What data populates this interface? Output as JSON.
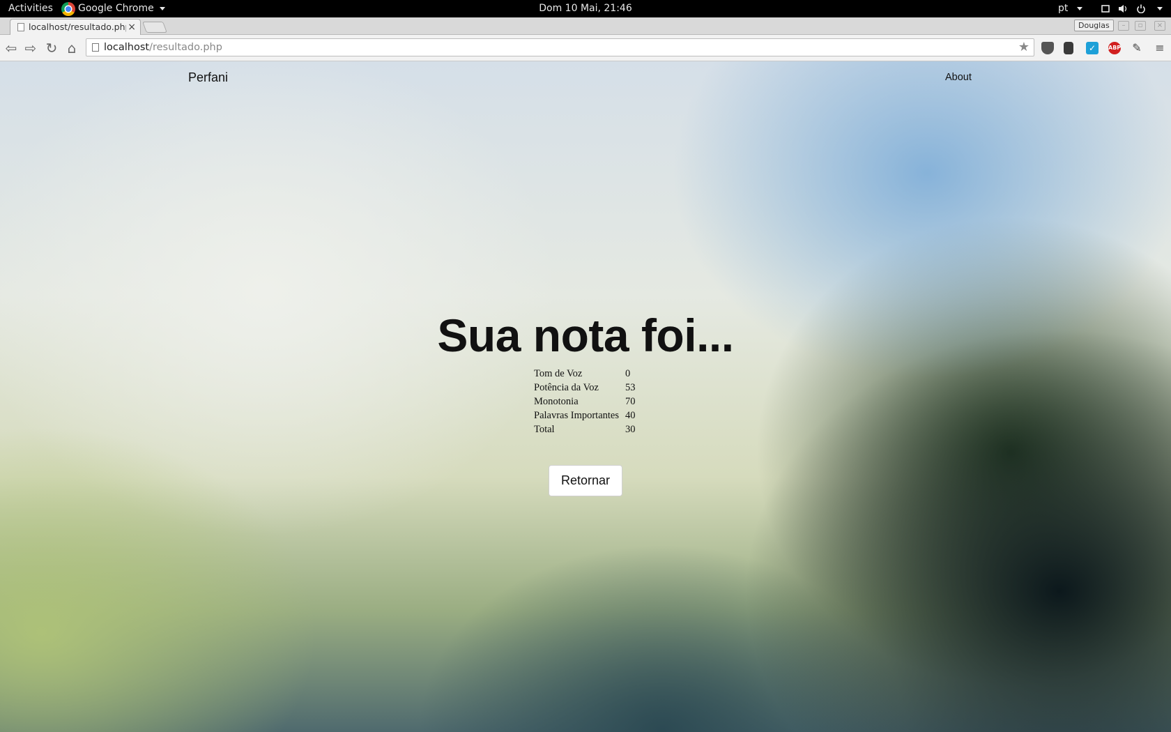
{
  "system_bar": {
    "activities": "Activities",
    "app_name": "Google Chrome",
    "clock": "Dom 10 Mai, 21:46",
    "language": "pt"
  },
  "browser": {
    "tab_title": "localhost/resultado.php",
    "tab_close": "×",
    "profile_name": "Douglas",
    "url_host": "localhost",
    "url_path": "/resultado.php",
    "extensions": [
      "pocket-icon",
      "evernote-icon",
      "todo-check-icon",
      "adblock-plus-icon",
      "devtools-icon"
    ],
    "adblock_label": "ABP"
  },
  "page": {
    "brand": "Perfani",
    "nav_about": "About",
    "headline": "Sua nota foi...",
    "scores": [
      {
        "label": "Tom de Voz",
        "value": "0"
      },
      {
        "label": "Potência da Voz",
        "value": "53"
      },
      {
        "label": "Monotonia",
        "value": "70"
      },
      {
        "label": "Palavras Importantes",
        "value": "40"
      },
      {
        "label": "Total",
        "value": "30"
      }
    ],
    "return_button": "Retornar"
  },
  "colors": {
    "sky_blue": "#78aad7",
    "dark_green": "#223a1e",
    "pale_green": "#afc378"
  }
}
